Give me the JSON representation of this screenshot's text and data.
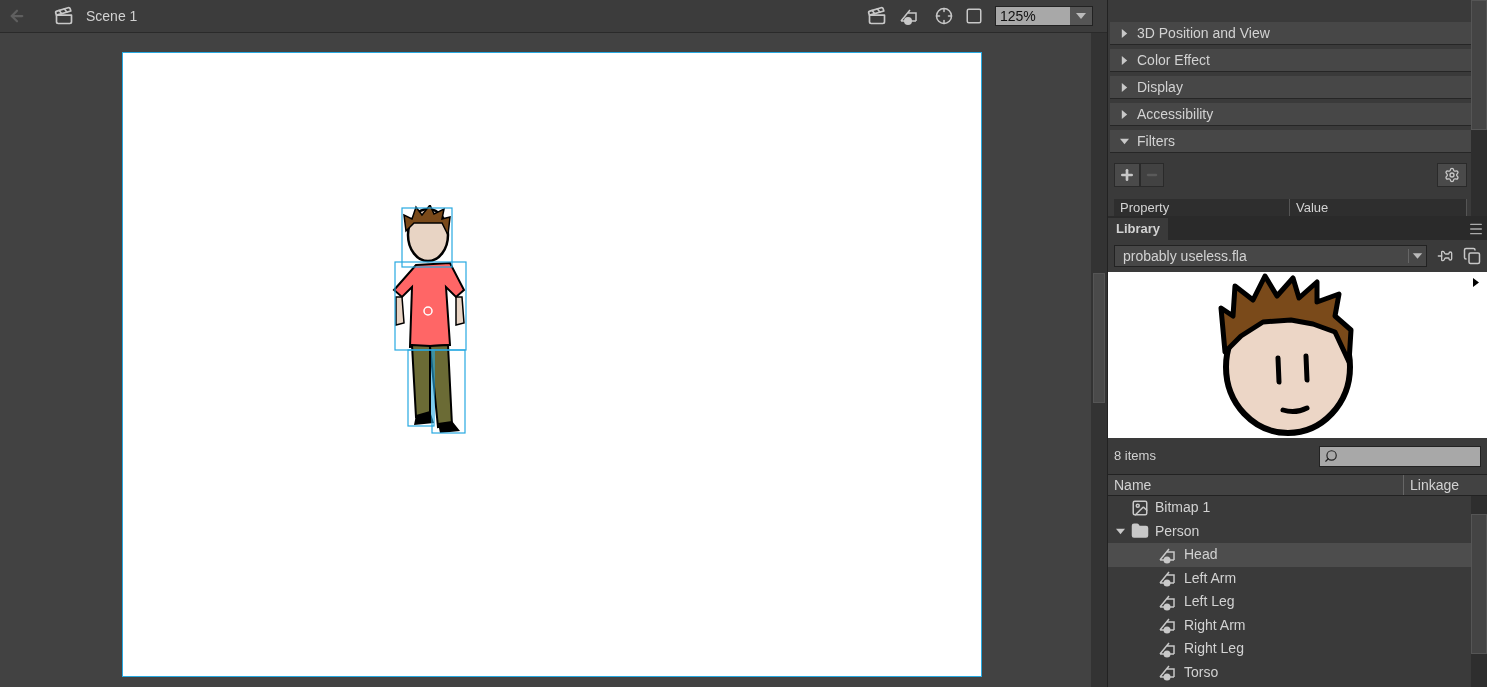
{
  "toolbar": {
    "scene": "Scene 1",
    "zoom": "125%"
  },
  "properties": {
    "sections": [
      {
        "title": "3D Position and View",
        "expanded": false
      },
      {
        "title": "Color Effect",
        "expanded": false
      },
      {
        "title": "Display",
        "expanded": false
      },
      {
        "title": "Accessibility",
        "expanded": false
      },
      {
        "title": "Filters",
        "expanded": true
      }
    ],
    "filter_columns": [
      "Property",
      "Value"
    ]
  },
  "library": {
    "tab": "Library",
    "document": "probably useless.fla",
    "item_count": "8 items",
    "columns": [
      "Name",
      "Linkage"
    ],
    "items": [
      {
        "name": "Bitmap 1",
        "kind": "bitmap",
        "selected": false
      },
      {
        "name": "Person",
        "kind": "folder",
        "expanded": true,
        "selected": false,
        "children": [
          {
            "name": "Head",
            "kind": "symbol",
            "selected": true
          },
          {
            "name": "Left Arm",
            "kind": "symbol",
            "selected": false
          },
          {
            "name": "Left Leg",
            "kind": "symbol",
            "selected": false
          },
          {
            "name": "Right Arm",
            "kind": "symbol",
            "selected": false
          },
          {
            "name": "Right Leg",
            "kind": "symbol",
            "selected": false
          },
          {
            "name": "Torso",
            "kind": "symbol",
            "selected": false
          }
        ]
      }
    ]
  }
}
